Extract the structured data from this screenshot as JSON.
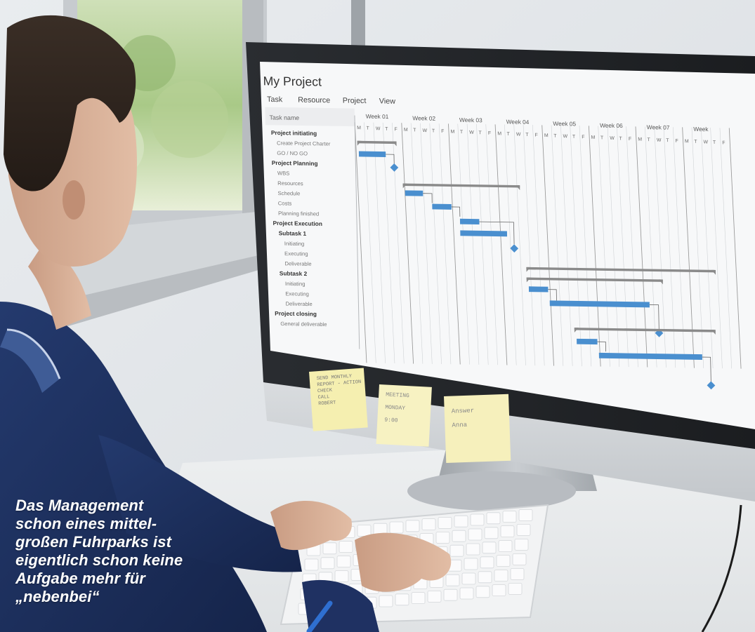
{
  "screen": {
    "app_title": "My Project",
    "menu": [
      "Task",
      "Resource",
      "Project",
      "View"
    ],
    "task_header": "Task name",
    "tasks": [
      "Project initiating",
      "Create Project Charter",
      "GO / NO GO",
      "Project Planning",
      "WBS",
      "Resources",
      "Schedule",
      "Costs",
      "Planning finished",
      "Project Execution",
      "Subtask 1",
      "Initiating",
      "Executing",
      "Deliverable",
      "Subtask 2",
      "Initiating",
      "Executing",
      "Deliverable",
      "Project closing",
      "General deliverable"
    ],
    "weeks": [
      "Week 01",
      "Week 02",
      "Week 03",
      "Week 04",
      "Week 05",
      "Week 06",
      "Week 07",
      "Week"
    ],
    "day_letters": [
      "M",
      "T",
      "W",
      "T",
      "F"
    ]
  },
  "sticky_notes": [
    {
      "lines": [
        "SEND MONTHLY",
        "REPORT  - ACTION",
        "CHECK",
        "CALL",
        "ROBERT"
      ]
    },
    {
      "lines": [
        "MEETING",
        "MONDAY",
        "9:00"
      ]
    },
    {
      "lines": [
        "Answer",
        "Anna"
      ]
    }
  ],
  "caption": {
    "lines": [
      "Das Management",
      "schon eines mittel-",
      "großen Fuhrparks ist",
      "eigentlich schon keine",
      "Aufgabe mehr für",
      "„nebenbei“"
    ]
  },
  "colors": {
    "bar_blue": "#4a8fcf",
    "summary_gray": "#8a8a8a",
    "caption_text": "#ffffff",
    "sweater_navy": "#1e2f5a"
  }
}
